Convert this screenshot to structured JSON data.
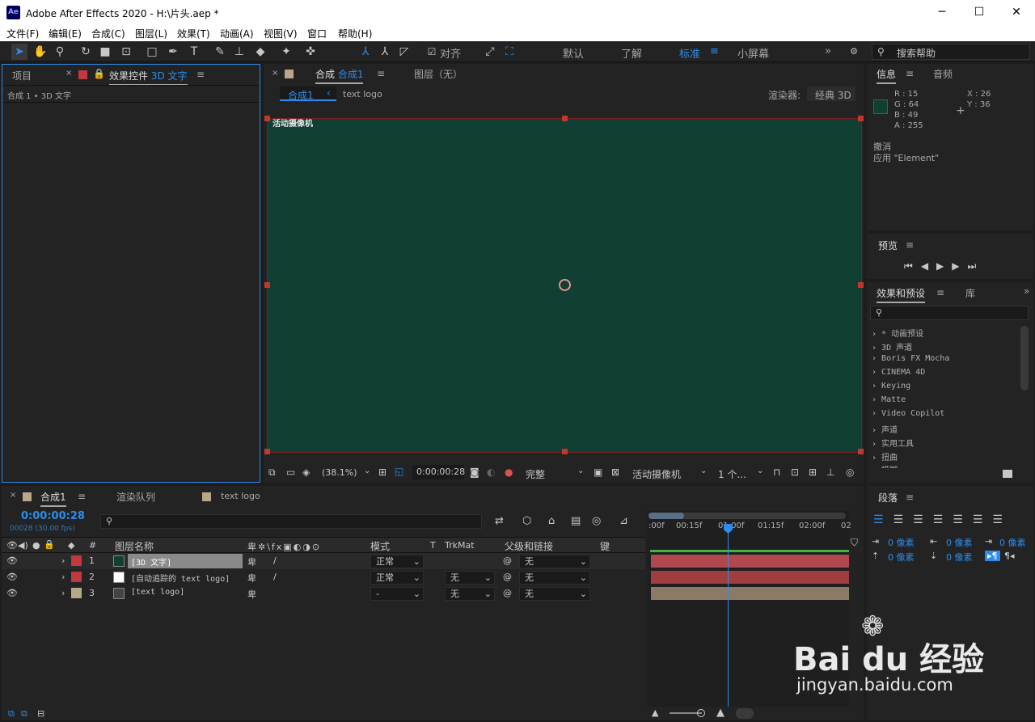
{
  "app": {
    "title": "Adobe After Effects 2020 - H:\\片头.aep *",
    "logo": "Ae"
  },
  "menu": [
    "文件(F)",
    "编辑(E)",
    "合成(C)",
    "图层(L)",
    "效果(T)",
    "动画(A)",
    "视图(V)",
    "窗口",
    "帮助(H)"
  ],
  "toolbar": {
    "snap_label": "对齐",
    "workspaces": [
      "默认",
      "了解",
      "标准",
      "小屏幕"
    ],
    "active_workspace": "标准",
    "search_placeholder": "搜索帮助"
  },
  "left_panel": {
    "tab_project": "项目",
    "tab_effects_prefix": "效果控件",
    "tab_effects_layer": "3D 文字",
    "breadcrumb": "合成 1 • 3D 文字"
  },
  "comp_panel": {
    "tab_label": "合成",
    "tab_name": "合成1",
    "tab_layer": "图层（无）",
    "flow_active": "合成1",
    "flow_next": "text logo",
    "renderer_label": "渲染器:",
    "renderer_value": "经典 3D",
    "camera_label": "活动摄像机"
  },
  "viewer_bar": {
    "zoom": "(38.1%)",
    "timecode": "0:00:00:28",
    "quality": "完整",
    "camera": "活动摄像机",
    "views": "1 个..."
  },
  "info_panel": {
    "tab_info": "信息",
    "tab_audio": "音频",
    "r": "R : 15",
    "g": "G : 64",
    "b": "B : 49",
    "a": "A : 255",
    "x": "X : 26",
    "y": "Y : 36",
    "history1": "撤消",
    "history2": "应用 \"Element\"",
    "swatch_color": "#0f4031"
  },
  "preview_panel": {
    "title": "预览"
  },
  "effects_panel": {
    "tab": "效果和预设",
    "tab2": "库",
    "items": [
      "* 动画预设",
      "3D 声道",
      "Boris FX Mocha",
      "CINEMA 4D",
      "Keying",
      "Matte",
      "Video Copilot",
      "声道",
      "实用工具",
      "扭曲",
      "模糊"
    ]
  },
  "timeline": {
    "tab_comp": "合成1",
    "tab_render": "渲染队列",
    "tab_textlogo": "text logo",
    "timecode": "0:00:00:28",
    "frames": "00028 (30.00 fps)",
    "col_num": "#",
    "col_name": "图层名称",
    "col_mode": "模式",
    "col_t": "T",
    "col_trkmat": "TrkMat",
    "col_parent": "父级和链接",
    "col_key": "键",
    "ruler": [
      ":00f",
      "00:15f",
      "01:00f",
      "01:15f",
      "02:00f",
      "02"
    ],
    "layers": [
      {
        "num": "1",
        "name": "[3D 文字]",
        "mode": "正常",
        "trkmat": "",
        "parent": "无",
        "label_color": "#c0393f",
        "thumb_color": "#113f34",
        "bar_color": "#b0484d"
      },
      {
        "num": "2",
        "name": "[自动追踪的 text logo]",
        "mode": "正常",
        "trkmat": "无",
        "parent": "无",
        "label_color": "#c0393f",
        "thumb_color": "#ffffff",
        "bar_color": "#9f3d41"
      },
      {
        "num": "3",
        "name": "[text logo]",
        "mode": "-",
        "trkmat": "无",
        "parent": "无",
        "label_color": "#b8a88a",
        "thumb_color": "#444444",
        "bar_color": "#8a7a66"
      }
    ]
  },
  "paragraph_panel": {
    "title": "段落",
    "v1": "0 像素",
    "v2": "0 像素",
    "v3": "0 像素",
    "v4": "0 像素",
    "v5": "0 像素"
  },
  "watermark": {
    "brand": "Bai du 经验",
    "url": "jingyan.baidu.com"
  }
}
